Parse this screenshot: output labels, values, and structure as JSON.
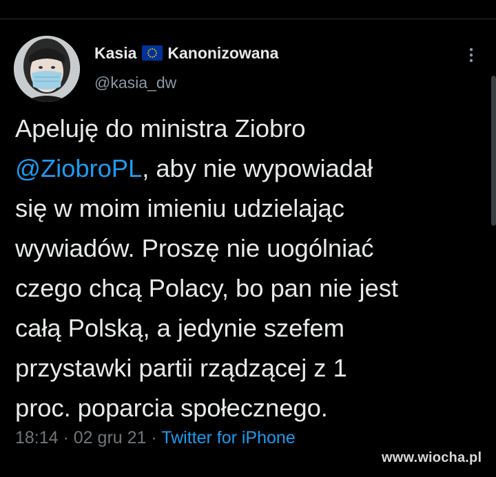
{
  "tweet": {
    "author": {
      "name_first": "Kasia",
      "flag_icon": "eu-flag-icon",
      "name_last": "Kanonizowana",
      "handle": "@kasia_dw"
    },
    "text": {
      "line1": "Apeluję do ministra Ziobro",
      "mention": "@ZiobroPL",
      "line2_rest": ", aby nie wypowiadał",
      "line3": "się w moim imieniu udzielając",
      "line4": "wywiadów. Proszę nie uogólniać",
      "line5": "czego chcą Polacy, bo pan nie jest",
      "line6": "całą Polską, a jedynie szefem",
      "line7": "przystawki partii rządzącej z 1",
      "line8": "proc. poparcia społecznego."
    },
    "meta": {
      "time": "18:14",
      "separator1": " · ",
      "date": "02 gru 21",
      "separator2": " · ",
      "source": "Twitter for iPhone"
    }
  },
  "watermark": "www.wiocha.pl",
  "colors": {
    "background": "#000000",
    "text": "#e7e9ea",
    "secondary": "#71767b",
    "link": "#1d9bf0",
    "eu_blue": "#003399",
    "eu_star": "#ffcc00"
  }
}
